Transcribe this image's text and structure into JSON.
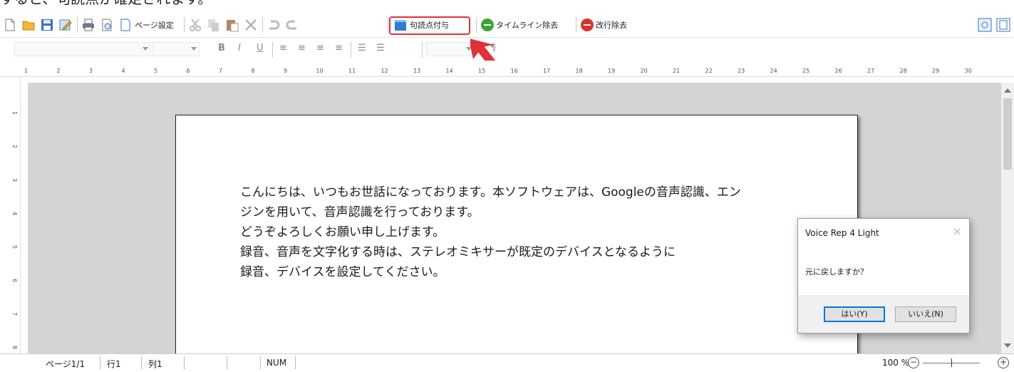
{
  "caption": "すると、句読点が確定されます。",
  "toolbar": {
    "page_setup_label": "ページ設定",
    "punctuation_label": "句読点付与",
    "remove_timeline_label": "タイムライン除去",
    "remove_linebreak_label": "改行除去"
  },
  "format_bar": {
    "bold": "B",
    "italic": "I",
    "underline": "U",
    "pilcrow": "¶"
  },
  "ruler_ticks": [
    "1",
    "2",
    "3",
    "4",
    "5",
    "6",
    "7",
    "8",
    "9",
    "10",
    "11",
    "12",
    "13",
    "14",
    "15",
    "16",
    "17",
    "18",
    "19",
    "20",
    "21",
    "22",
    "23",
    "24",
    "25",
    "26",
    "27",
    "28",
    "29",
    "30"
  ],
  "vruler_ticks": [
    "1",
    "2",
    "3",
    "4",
    "5",
    "6",
    "7",
    "8"
  ],
  "document": {
    "lines": [
      "こんにちは、いつもお世話になっております。本ソフトウェアは、Googleの音声認識、エン",
      "ジンを用いて、音声認識を行っております。",
      "どうぞよろしくお願い申し上げます。",
      "録音、音声を文字化する時は、ステレオミキサーが既定のデバイスとなるように",
      "録音、デバイスを設定してください。"
    ]
  },
  "dialog": {
    "title": "Voice Rep 4 Light",
    "close": "×",
    "message": "元に戻しますか？",
    "yes_label": "はい(Y)",
    "no_label": "いいえ(N)"
  },
  "status": {
    "page": "ページ1/1",
    "line": "行1",
    "col": "列1",
    "num": "NUM",
    "zoom": "100 %"
  },
  "colors": {
    "highlight": "#e0303a",
    "remove_green": "#3aa53a",
    "remove_red": "#d9342b",
    "accent": "#0078d7"
  }
}
